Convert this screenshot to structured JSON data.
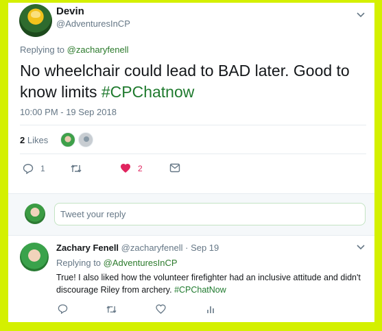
{
  "tweet": {
    "author_name": "Devin",
    "author_handle": "@AdventuresInCP",
    "replying_prefix": "Replying to",
    "replying_to": "@zacharyfenell",
    "text": "No wheelchair could lead to BAD later. Good to know limits ",
    "hashtag": "#CPChatnow",
    "timestamp": "10:00 PM - 19 Sep 2018",
    "likes_count": "2",
    "likes_label": "Likes",
    "reply_count": "1",
    "like_count": "2"
  },
  "reply_compose": {
    "placeholder": "Tweet your reply"
  },
  "reply": {
    "author_name": "Zachary Fenell",
    "author_handle": "@zacharyfenell",
    "separator": "·",
    "date": "Sep 19",
    "replying_prefix": "Replying to",
    "replying_to": "@AdventuresInCP",
    "text": "True! I also liked how the volunteer firefighter had an inclusive attitude and didn't discourage Riley from archery. ",
    "hashtag": "#CPChatNow"
  },
  "colors": {
    "frame": "#d4f000",
    "link_green": "#2b7a2b",
    "like_red": "#e0245e",
    "muted": "#657786"
  },
  "icons": [
    "chevron-down-icon",
    "reply-icon",
    "retweet-icon",
    "heart-icon",
    "message-icon",
    "analytics-icon"
  ]
}
